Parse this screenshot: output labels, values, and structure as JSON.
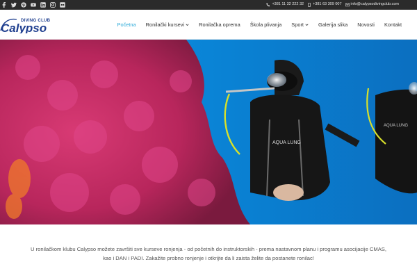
{
  "topbar": {
    "social_icons": [
      "facebook-icon",
      "twitter-icon",
      "pinterest-icon",
      "youtube-icon",
      "linkedin-icon",
      "instagram-icon",
      "flickr-icon"
    ],
    "phone_1": "+381 11 32 222 32",
    "phone_2": "+381 63 309 007",
    "email": "info@calypsodivingclub.com"
  },
  "logo": {
    "top_text": "DIVING CLUB",
    "main_text": "Calypso",
    "color": "#1f3f8f"
  },
  "nav": {
    "items": [
      {
        "label": "Početna",
        "active": true
      },
      {
        "label": "Ronilački kursevi",
        "dropdown": true
      },
      {
        "label": "Ronilačka oprema"
      },
      {
        "label": "Škola plivanja"
      },
      {
        "label": "Sport",
        "dropdown": true
      },
      {
        "label": "Galerija slika"
      },
      {
        "label": "Novosti"
      },
      {
        "label": "Kontakt"
      }
    ],
    "active_color": "#2aa9d8"
  },
  "hero": {
    "image": "diver-with-red-coral-photo",
    "suit_text_1": "AQUA LUNG",
    "suit_text_2": "AQUA LUNG"
  },
  "intro": {
    "text": "U ronilačkom klubu Calypso možete završiti sve kurseve ronjenja - od početnih do instruktorskih - prema nastavnom planu i programu asocijacije CMAS, kao i DAN i PADI. Zakažite probno ronjenje i otkrijte da li zaista želite da postanete ronilac!"
  }
}
